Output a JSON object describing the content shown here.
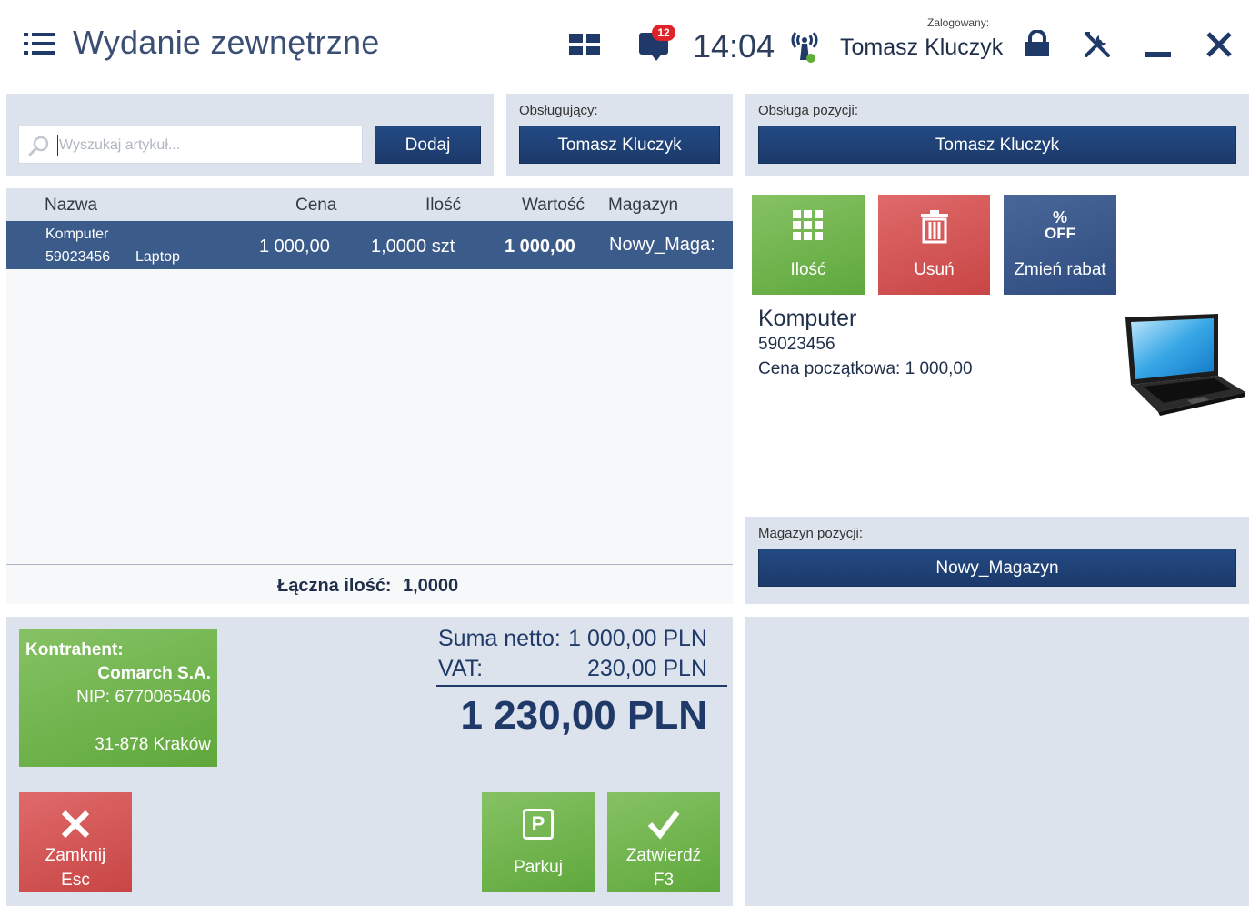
{
  "header": {
    "title": "Wydanie zewnętrzne",
    "time": "14:04",
    "notifications_count": "12",
    "logged_label": "Zalogowany:",
    "logged_user": "Tomasz Kluczyk",
    "icons": [
      "menu-icon",
      "tiles-icon",
      "messages-icon",
      "signal-icon",
      "lock-icon",
      "tools-icon",
      "minimize-icon",
      "close-icon"
    ]
  },
  "search": {
    "placeholder": "Wyszukaj artykuł...",
    "add_label": "Dodaj"
  },
  "operator": {
    "label": "Obsługujący:",
    "value": "Tomasz Kluczyk"
  },
  "item_operator": {
    "label": "Obsługa pozycji:",
    "value": "Tomasz Kluczyk"
  },
  "table": {
    "columns": [
      "Nazwa",
      "Cena",
      "Ilość",
      "Wartość",
      "Magazyn"
    ],
    "rows": [
      {
        "name": "Komputer",
        "code": "59023456",
        "category": "Laptop",
        "price": "1 000,00",
        "quantity": "1,0000 szt",
        "value": "1 000,00",
        "warehouse": "Nowy_Maga:"
      }
    ],
    "total_qty_label": "Łączna ilość:",
    "total_qty_value": "1,0000"
  },
  "actions": {
    "quantity_label": "Ilość",
    "delete_label": "Usuń",
    "discount_label": "Zmień rabat",
    "discount_icon_text_1": "%",
    "discount_icon_text_2": "OFF"
  },
  "detail": {
    "name": "Komputer",
    "code": "59023456",
    "initial_price_label": "Cena początkowa:",
    "initial_price_value": "1 000,00"
  },
  "warehouse": {
    "label": "Magazyn pozycji:",
    "value": "Nowy_Magazyn"
  },
  "contractor": {
    "label": "Kontrahent:",
    "name": "Comarch S.A.",
    "nip": "NIP: 6770065406",
    "city": "31-878 Kraków"
  },
  "totals": {
    "net_label": "Suma netto:",
    "net_value": "1 000,00 PLN",
    "vat_label": "VAT:",
    "vat_value": "230,00 PLN",
    "grand_total": "1 230,00 PLN"
  },
  "footer": {
    "close_label": "Zamknij",
    "close_key": "Esc",
    "park_label": "Parkuj",
    "park_icon_text": "P",
    "confirm_label": "Zatwierdź",
    "confirm_key": "F3"
  },
  "colors": {
    "navy": "#1f3a68",
    "panel": "#dde3ec",
    "selected_row": "#3b5b8a",
    "green": "#6cb24a",
    "red": "#d45656",
    "slate_blue": "#3d5a8c",
    "badge_red": "#e0232a"
  }
}
